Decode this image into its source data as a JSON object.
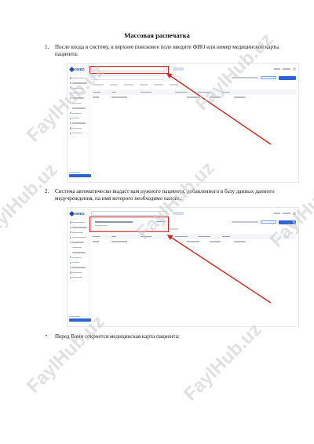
{
  "page": {
    "title": "Массовая распечатка"
  },
  "steps": [
    {
      "number": "1.",
      "text": "После входа в систему, в верхнее поисковое поле введите ФИО или номер медицинской карты пациента:"
    },
    {
      "number": "2.",
      "text": "Система автоматически выдаст вам нужного пациента, добавленного в базу данных данного медучреждения, на имя которого необходимо нажать:"
    },
    {
      "number": "•",
      "text": "Перед Вами откроется медицинская карта пациента:"
    }
  ],
  "screenshot": {
    "logo_text": "DMED",
    "colors": {
      "brand": "#1c4fb3",
      "primary_button": "#2e63d1",
      "highlight": "#d7261e"
    }
  },
  "watermark": {
    "text": "FaylHub.uz"
  }
}
